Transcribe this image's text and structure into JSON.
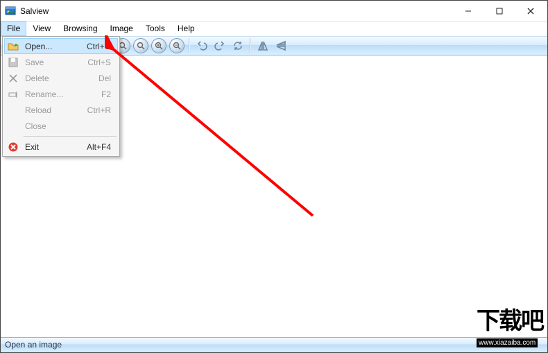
{
  "window": {
    "title": "Salview"
  },
  "menubar": [
    "File",
    "View",
    "Browsing",
    "Image",
    "Tools",
    "Help"
  ],
  "file_menu": {
    "open": {
      "label": "Open...",
      "shortcut": "Ctrl+O"
    },
    "save": {
      "label": "Save",
      "shortcut": "Ctrl+S"
    },
    "delete": {
      "label": "Delete",
      "shortcut": "Del"
    },
    "rename": {
      "label": "Rename...",
      "shortcut": "F2"
    },
    "reload": {
      "label": "Reload",
      "shortcut": "Ctrl+R"
    },
    "close": {
      "label": "Close",
      "shortcut": ""
    },
    "exit": {
      "label": "Exit",
      "shortcut": "Alt+F4"
    }
  },
  "statusbar": {
    "text": "Open an image"
  },
  "watermark": {
    "big": "下载吧",
    "url": "www.xiazaiba.com"
  },
  "toolbar_names": [
    "open",
    "save",
    "sep",
    "copy",
    "sep",
    "prev",
    "next",
    "sep",
    "zoom-fit",
    "zoom-actual",
    "zoom-in",
    "zoom-out",
    "sep",
    "undo",
    "redo",
    "refresh",
    "sep",
    "flip-h",
    "flip-v"
  ]
}
